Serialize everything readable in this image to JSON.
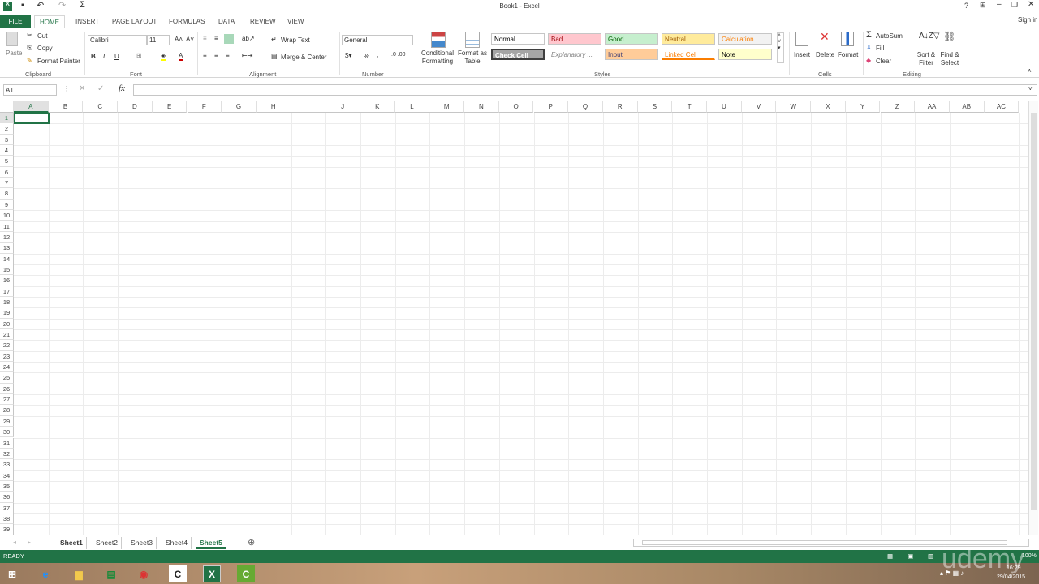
{
  "title": "Book1 - Excel",
  "quick_access": {
    "icons": [
      "excel-logo-icon",
      "save-icon",
      "undo-icon",
      "redo-icon",
      "autosum-icon"
    ]
  },
  "window": {
    "help": "?",
    "sign_in": "Sign in"
  },
  "tabs": [
    "FILE",
    "HOME",
    "INSERT",
    "PAGE LAYOUT",
    "FORMULAS",
    "DATA",
    "REVIEW",
    "VIEW"
  ],
  "ribbon": {
    "clipboard": {
      "paste": "Paste",
      "cut": "Cut",
      "copy": "Copy",
      "format_painter": "Format Painter",
      "label": "Clipboard"
    },
    "font": {
      "name": "Calibri",
      "size": "11",
      "bold": "B",
      "italic": "I",
      "underline": "U",
      "label": "Font"
    },
    "alignment": {
      "wrap": "Wrap Text",
      "merge": "Merge & Center",
      "label": "Alignment"
    },
    "number": {
      "format": "General",
      "percent": "%",
      "comma": ",",
      "label": "Number"
    },
    "styles": {
      "conditional": "Conditional Formatting",
      "format_table": "Format as Table",
      "label": "Styles",
      "cells": [
        {
          "label": "Normal",
          "bg": "#ffffff",
          "fg": "#000000"
        },
        {
          "label": "Bad",
          "bg": "#ffc7ce",
          "fg": "#9c0006"
        },
        {
          "label": "Good",
          "bg": "#c6efce",
          "fg": "#006100"
        },
        {
          "label": "Neutral",
          "bg": "#ffeb9c",
          "fg": "#9c5700"
        },
        {
          "label": "Calculation",
          "bg": "#f2f2f2",
          "fg": "#fa7d00"
        },
        {
          "label": "Check Cell",
          "bg": "#a5a5a5",
          "fg": "#ffffff"
        },
        {
          "label": "Explanatory ...",
          "bg": "#ffffff",
          "fg": "#7f7f7f"
        },
        {
          "label": "Input",
          "bg": "#ffcc99",
          "fg": "#3f3f76"
        },
        {
          "label": "Linked Cell",
          "bg": "#ffffff",
          "fg": "#fa7d00"
        },
        {
          "label": "Note",
          "bg": "#ffffcc",
          "fg": "#000000"
        }
      ]
    },
    "cells": {
      "insert": "Insert",
      "delete": "Delete",
      "format": "Format",
      "label": "Cells"
    },
    "editing": {
      "autosum": "AutoSum",
      "fill": "Fill",
      "clear": "Clear",
      "sort": "Sort & Filter",
      "find": "Find & Select",
      "label": "Editing"
    }
  },
  "formula_bar": {
    "name_box": "A1",
    "fx": "fx",
    "value": ""
  },
  "columns": [
    "A",
    "B",
    "C",
    "D",
    "E",
    "F",
    "G",
    "H",
    "I",
    "J",
    "K",
    "L",
    "M",
    "N",
    "O",
    "P",
    "Q",
    "R",
    "S",
    "T",
    "U",
    "V",
    "W",
    "X",
    "Y",
    "Z",
    "AA",
    "AB",
    "AC"
  ],
  "rows": 39,
  "active_cell": "A1",
  "sheets": [
    {
      "name": "Sheet1",
      "bold": true
    },
    {
      "name": "Sheet2"
    },
    {
      "name": "Sheet3"
    },
    {
      "name": "Sheet4"
    },
    {
      "name": "Sheet5",
      "active": true
    }
  ],
  "status": {
    "mode": "READY",
    "zoom": "100%"
  },
  "taskbar": {
    "time": "16:29",
    "date": "29/04/2015"
  },
  "watermark": "udemy",
  "colors": {
    "accent": "#217346"
  }
}
